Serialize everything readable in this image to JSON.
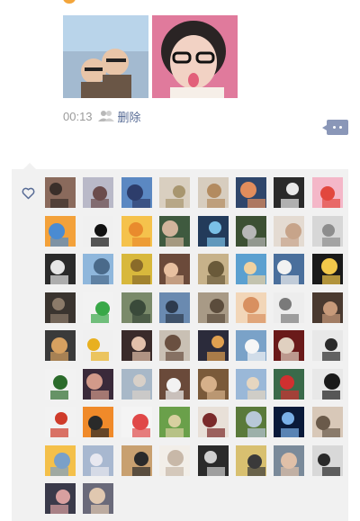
{
  "post": {
    "time": "00:13",
    "delete_label": "删除",
    "photos": [
      {
        "icon": "couple-selfie",
        "colors": [
          "#b9d4ea",
          "#6a5646",
          "#e8c5a8"
        ]
      },
      {
        "icon": "woman-selfie",
        "colors": [
          "#e07a9c",
          "#2a2424",
          "#f2d2c4"
        ]
      }
    ]
  },
  "likes": {
    "icon": "heart-outline",
    "avatars": [
      [
        "#8a6a5c",
        "#3a2f2a"
      ],
      [
        "#b9b9c8",
        "#6b4c4c"
      ],
      [
        "#5b88c2",
        "#2d3d6b"
      ],
      [
        "#d9cfc0",
        "#a8966f"
      ],
      [
        "#d7cdbf",
        "#b38b60"
      ],
      [
        "#2f466b",
        "#e28d5c"
      ],
      [
        "#2a2a2a",
        "#e9e9e9"
      ],
      [
        "#f4b7c8",
        "#e2473e"
      ],
      [
        "#f3a13a",
        "#4a8bd2"
      ],
      [
        "#f0f0f0",
        "#111111"
      ],
      [
        "#f5c24c",
        "#e98b2d"
      ],
      [
        "#3f5a3f",
        "#d2b49c"
      ],
      [
        "#233b5a",
        "#7ac0e6"
      ],
      [
        "#3c5033",
        "#b7b7b7"
      ],
      [
        "#e4dbd2",
        "#c7a48a"
      ],
      [
        "#d7d7d7",
        "#8d8d8d"
      ],
      [
        "#2b2b2b",
        "#e6e6e6"
      ],
      [
        "#8fb7dc",
        "#4a6a8a"
      ],
      [
        "#d8b83c",
        "#8a6b2a"
      ],
      [
        "#6b4a3a",
        "#e8c0a0"
      ],
      [
        "#c7b28a",
        "#6a5a3a"
      ],
      [
        "#5ba0d0",
        "#f0d2a0"
      ],
      [
        "#4a6f9c",
        "#f2f2f2"
      ],
      [
        "#1a1a1a",
        "#f2c84a"
      ],
      [
        "#3a342f",
        "#8b7a69"
      ],
      [
        "#f2f2f2",
        "#39a848"
      ],
      [
        "#7a8a6a",
        "#3a4a3a"
      ],
      [
        "#6a8ab0",
        "#2d3a4d"
      ],
      [
        "#a89a86",
        "#5b4c3c"
      ],
      [
        "#f2d6b8",
        "#d89060"
      ],
      [
        "#ededed",
        "#7a7a7a"
      ],
      [
        "#4a3a30",
        "#c79a7a"
      ],
      [
        "#3a3a3a",
        "#d6a060"
      ],
      [
        "#f0f0f0",
        "#e8b020"
      ],
      [
        "#3a2b2a",
        "#e2c0aa"
      ],
      [
        "#c9c0b4",
        "#6a5040"
      ],
      [
        "#2b2b3b",
        "#e0a050"
      ],
      [
        "#7aa2c8",
        "#f6f6f6"
      ],
      [
        "#6a1a1a",
        "#e0d0c0"
      ],
      [
        "#e8e8e8",
        "#2a2a2a"
      ],
      [
        "#f2f2f2",
        "#2b6b2b"
      ],
      [
        "#3a2a3a",
        "#d29a8a"
      ],
      [
        "#a8b8c8",
        "#d8d0c8"
      ],
      [
        "#6a4a3a",
        "#f2f2f2"
      ],
      [
        "#7a5a3a",
        "#d6b08a"
      ],
      [
        "#9ab8d8",
        "#e6d6c0"
      ],
      [
        "#3a6a4a",
        "#d03030"
      ],
      [
        "#e8e8e8",
        "#1a1a1a"
      ],
      [
        "#f2f2f2",
        "#cf3b2a"
      ],
      [
        "#f08a2a",
        "#2a2a2a"
      ],
      [
        "#f4f4f4",
        "#e04848"
      ],
      [
        "#6aa04a",
        "#d8d0a0"
      ],
      [
        "#e8e0d8",
        "#7a2a2a"
      ],
      [
        "#5a7a3a",
        "#b8c8d8"
      ],
      [
        "#0a1a3a",
        "#7ab0e8"
      ],
      [
        "#d8c8b8",
        "#6a5a4a"
      ],
      [
        "#f4c04a",
        "#7aa0c8"
      ],
      [
        "#a8b8d0",
        "#e8e8f0"
      ],
      [
        "#c8a070",
        "#2a2a2a"
      ],
      [
        "#f2eee8",
        "#c8b8a8"
      ],
      [
        "#2a2a2a",
        "#d0d0d0"
      ],
      [
        "#d8c070",
        "#3a3a3a"
      ],
      [
        "#7a8a9a",
        "#e0c0a8"
      ],
      [
        "#d8d8d8",
        "#2a2a2a"
      ],
      [
        "#3a3a4a",
        "#d8a0a0"
      ],
      [
        "#6a6a7a",
        "#e0c8b0"
      ]
    ]
  }
}
